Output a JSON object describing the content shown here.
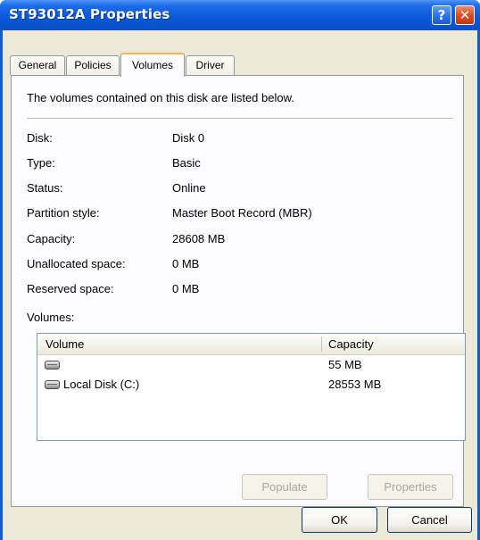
{
  "window": {
    "title": "ST93012A Properties",
    "help_label": "?",
    "close_label": "✕"
  },
  "tabs": [
    {
      "label": "General",
      "active": false
    },
    {
      "label": "Policies",
      "active": false
    },
    {
      "label": "Volumes",
      "active": true
    },
    {
      "label": "Driver",
      "active": false
    }
  ],
  "panel": {
    "intro": "The volumes contained on this disk are listed below.",
    "properties": [
      {
        "label": "Disk:",
        "value": "Disk 0"
      },
      {
        "label": "Type:",
        "value": "Basic"
      },
      {
        "label": "Status:",
        "value": "Online"
      },
      {
        "label": "Partition style:",
        "value": "Master Boot Record (MBR)"
      },
      {
        "label": "Capacity:",
        "value": "28608 MB"
      },
      {
        "label": "Unallocated space:",
        "value": "0 MB"
      },
      {
        "label": "Reserved space:",
        "value": "0 MB"
      }
    ],
    "volumes_heading": "Volumes:",
    "volume_table": {
      "columns": [
        "Volume",
        "Capacity"
      ],
      "rows": [
        {
          "volume": "",
          "capacity": "55 MB",
          "icon": "disk-drive-icon"
        },
        {
          "volume": "Local Disk (C:)",
          "capacity": "28553 MB",
          "icon": "disk-drive-icon"
        }
      ]
    },
    "populate_label": "Populate",
    "properties_label": "Properties"
  },
  "footer": {
    "ok_label": "OK",
    "cancel_label": "Cancel"
  }
}
